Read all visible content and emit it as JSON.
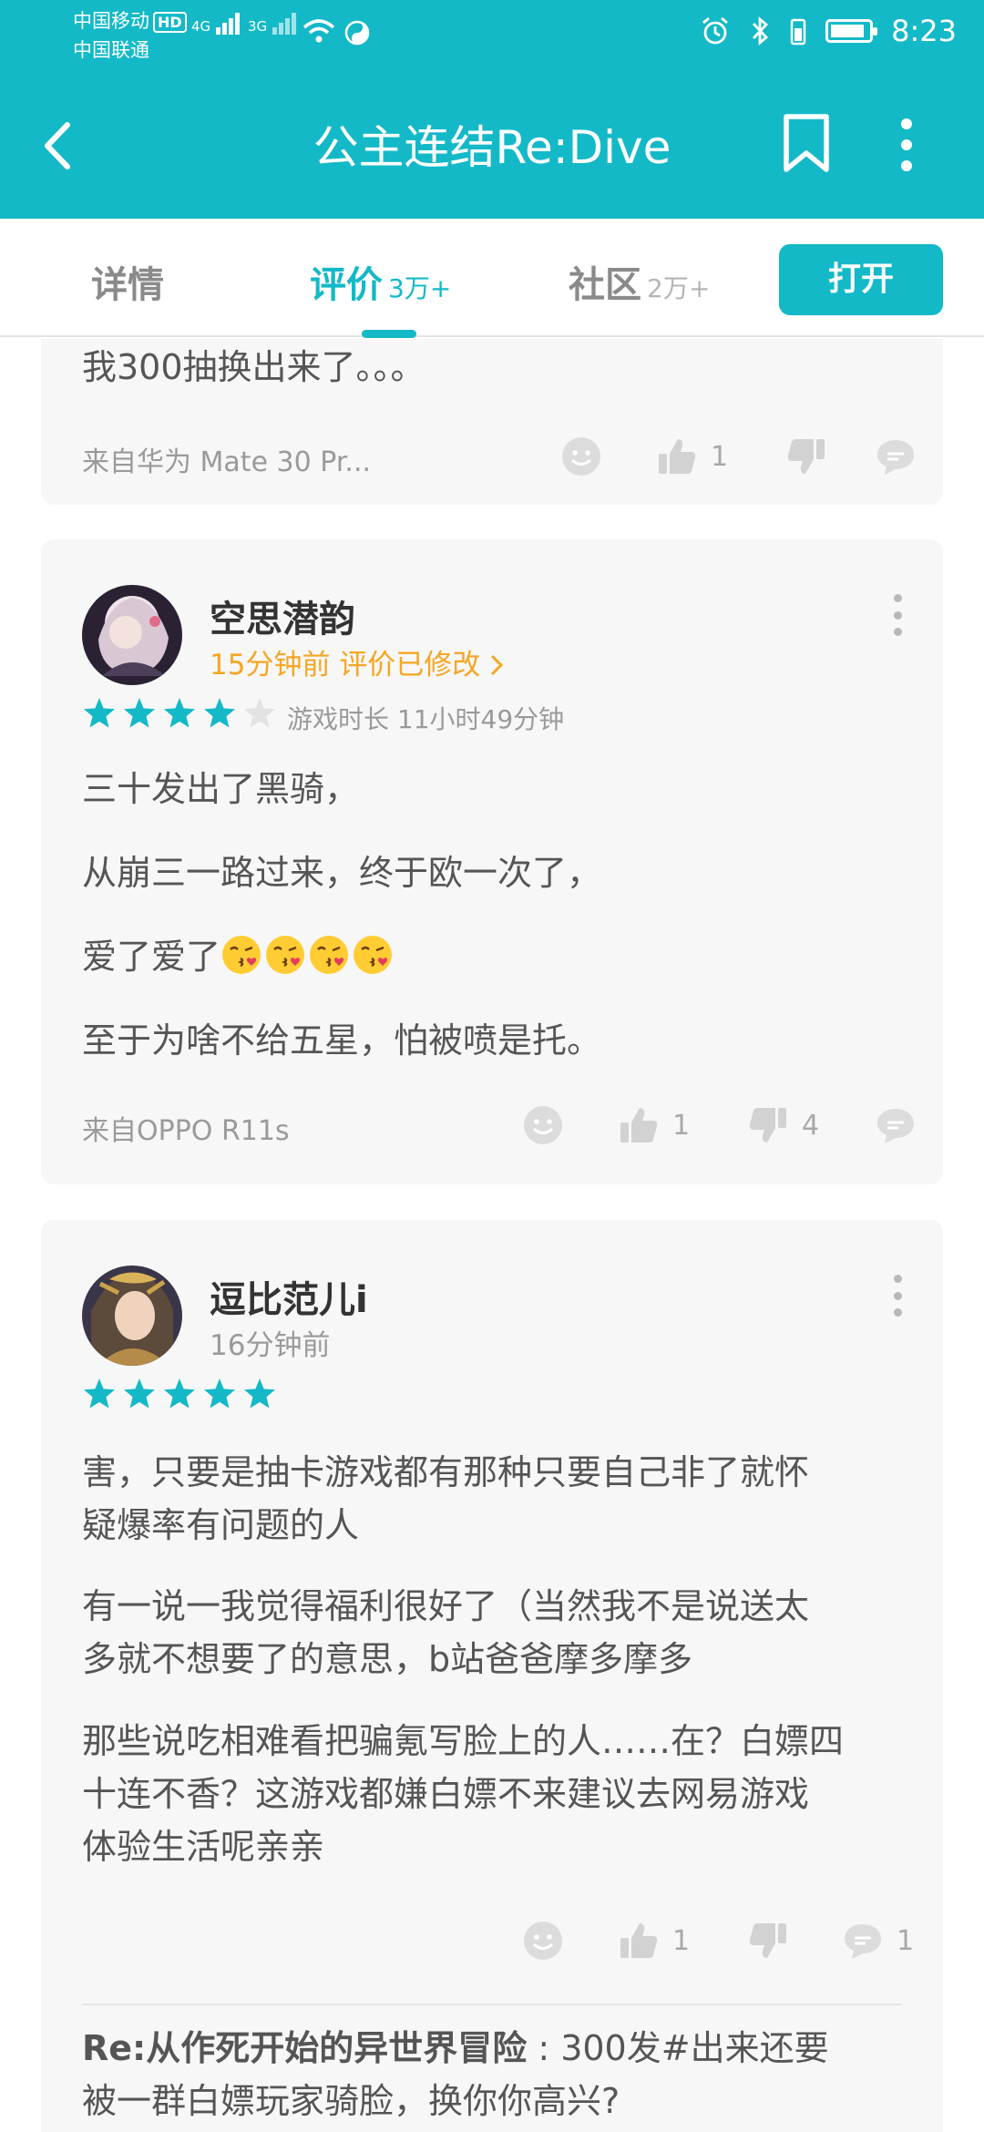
{
  "status_bar": {
    "carrier_1": "中国移动",
    "carrier_1_badge": "HD",
    "carrier_2": "中国联通",
    "net_1": "4G",
    "net_2": "3G",
    "time": "8:23"
  },
  "toolbar": {
    "title": "公主连结Re:Dive"
  },
  "tabs": [
    {
      "label": "详情",
      "count": ""
    },
    {
      "label": "评价",
      "count": "3万+"
    },
    {
      "label": "社区",
      "count": "2万+"
    }
  ],
  "open_button": "打开",
  "colors": {
    "accent": "#14b9c8",
    "star_empty": "#e3e3e3",
    "orange": "#f5a623"
  },
  "reviews": [
    {
      "lines": [
        "我300抽换出来了。。。"
      ],
      "device": "来自华为 Mate 30 Pr...",
      "likes": "1",
      "dislikes": "",
      "replies": ""
    },
    {
      "user": "空思潜韵",
      "time": "15分钟前",
      "edited": "评价已修改",
      "rating": 4,
      "playtime": "游戏时长 11小时49分钟",
      "lines": [
        "三十发出了黑骑，",
        "从崩三一路过来，终于欧一次了，",
        "爱了爱了",
        "至于为啥不给五星，怕被喷是托。"
      ],
      "emoji_count": 4,
      "device": "来自OPPO R11s",
      "likes": "1",
      "dislikes": "4",
      "replies": ""
    },
    {
      "user": "逗比范儿i",
      "time": "16分钟前",
      "rating": 5,
      "paragraphs": [
        [
          "害，只要是抽卡游戏都有那种只要自己非了就怀",
          "疑爆率有问题的人"
        ],
        [
          "有一说一我觉得福利很好了（当然我不是说送太",
          "多就不想要了的意思，b站爸爸摩多摩多"
        ],
        [
          "那些说吃相难看把骗氪写脸上的人……在？白嫖四",
          "十连不香？这游戏都嫌白嫖不来建议去网易游戏",
          "体验生活呢亲亲"
        ]
      ],
      "likes": "1",
      "dislikes": "",
      "replies": "1",
      "reply_preview": {
        "author": "Re:从作死开始的异世界冒险",
        "text_1": " : 300发#出来还要",
        "text_2": "被一群白嫖玩家骑脸，换你你高兴?"
      }
    }
  ]
}
